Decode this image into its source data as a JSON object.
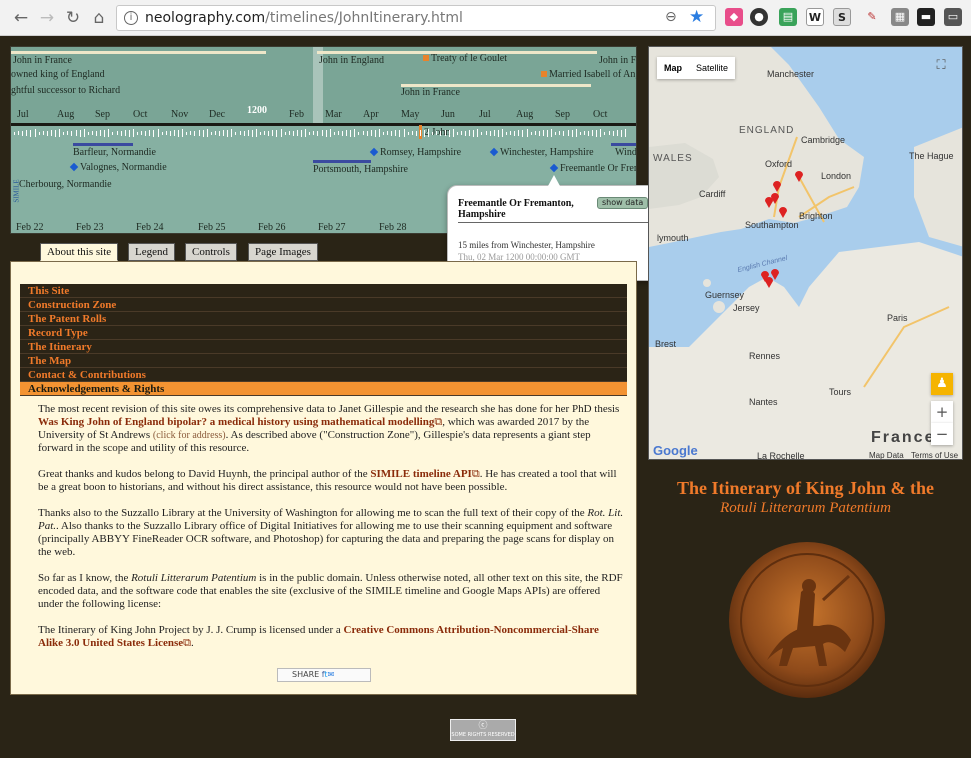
{
  "browser": {
    "url_host": "neolography.com",
    "url_path": "/timelines/JohnItinerary.html",
    "ext_icons": [
      "cube-icon",
      "user-secret-icon",
      "clipboard-icon",
      "w-icon",
      "s-icon",
      "evernote-icon",
      "extension-icon",
      "screen-icon",
      "window-icon"
    ]
  },
  "timeline": {
    "top_events": [
      "John in France",
      "owned king of England",
      "ghtful successor to Richard",
      "John in England",
      "Treaty of le Goulet",
      "John in France",
      "Married Isabell of Ang",
      "John in France"
    ],
    "year_label": "1200",
    "months": [
      "Jul",
      "Aug",
      "Sep",
      "Oct",
      "Nov",
      "Dec",
      "Feb",
      "Mar",
      "Apr",
      "May",
      "Jun",
      "Jul",
      "Aug",
      "Sep",
      "Oct"
    ],
    "marker_label": "2 John",
    "events": [
      "Barfleur, Normandie",
      "Valognes, Normandie",
      "Cherbourg, Normandie",
      "Portsmouth, Hampshire",
      "Romsey, Hampshire",
      "Winchester, Hampshire",
      "Freemantle Or Frem",
      "Winds"
    ],
    "days": [
      "Feb 22",
      "Feb 23",
      "Feb 24",
      "Feb 25",
      "Feb 26",
      "Feb 27",
      "Feb 28"
    ],
    "side_label": "SIMILE"
  },
  "popup": {
    "title": "Freemantle Or Fremanton, Hampshire",
    "button": "show data",
    "description": "15 miles from Winchester, Hampshire",
    "date": "Thu, 02 Mar 1200 00:00:00 GMT"
  },
  "tabs": [
    "About this site",
    "Legend",
    "Controls",
    "Page Images"
  ],
  "menu": [
    "This Site",
    "Construction Zone",
    "The Patent Rolls",
    "Record Type",
    "The Itinerary",
    "The Map",
    "Contact & Contributions",
    "Acknowledgements & Rights"
  ],
  "content": {
    "p1_a": "The most recent revision of this site owes its comprehensive data to Janet Gillespie and the research she has done for her PhD thesis ",
    "p1_link": "Was King John of England bipolar? a medical history using mathematical modelling",
    "p1_b": ", which was awarded 2017 by the University of St Andrews ",
    "p1_small": "(click for address)",
    "p1_c": ". As described above (\"Construction Zone\"), Gillespie's data represents a giant step forward in the scope and utility of this resource.",
    "p2_a": "Great thanks and kudos belong to David Huynh, the principal author of the ",
    "p2_link": "SIMILE timeline API",
    "p2_b": ". He has created a tool that will be a great boon to historians, and without his direct assistance, this resource would not have been possible.",
    "p3_a": "Thanks also to the Suzzallo Library at the University of Washington for allowing me to scan the full text of their copy of the ",
    "p3_em": "Rot. Lit. Pat.",
    "p3_b": ". Also thanks to the Suzzallo Library office of Digital Initiatives for allowing me to use their scanning equipment and software (principally ABBYY FineReader OCR software, and Photoshop) for capturing the data and preparing the page scans for display on the web.",
    "p4_a": "So far as I know, the ",
    "p4_em": "Rotuli Litterarum Patentium",
    "p4_b": " is in the public domain. Unless otherwise noted, all other text on this site, the RDF encoded data, and the software code that enables the site (exclusive of the SIMILE timeline and Google Maps APIs) are offered under the following license:",
    "p5_a": "The Itinerary of King John Project by J. J. Crump is licensed under a ",
    "p5_link": "Creative Commons Attribution-Noncommercial-Share Alike 3.0 United States License",
    "p5_b": ".",
    "share": "SHARE"
  },
  "map": {
    "type_map": "Map",
    "type_satellite": "Satellite",
    "labels": [
      "Manchester",
      "ENGLAND",
      "Cambridge",
      "WALES",
      "Oxford",
      "London",
      "The Hague",
      "Cardiff",
      "Brighton",
      "Southampton",
      "lymouth",
      "English Channel",
      "Guernsey",
      "Jersey",
      "Brest",
      "Paris",
      "Rennes",
      "Nantes",
      "Tours",
      "France",
      "La Rochelle"
    ],
    "footer_data": "Map Data",
    "footer_terms": "Terms of Use",
    "google": "Google"
  },
  "site": {
    "title": "The Itinerary of King John & the",
    "subtitle": "Rotuli Litterarum Patentium"
  },
  "cc_badge": "SOME RIGHTS RESERVED",
  "colors": {
    "accent": "#f07a2a",
    "menu_bg": "#2b2416",
    "content_bg": "#fff8dc",
    "page_bg": "#2a2416"
  }
}
